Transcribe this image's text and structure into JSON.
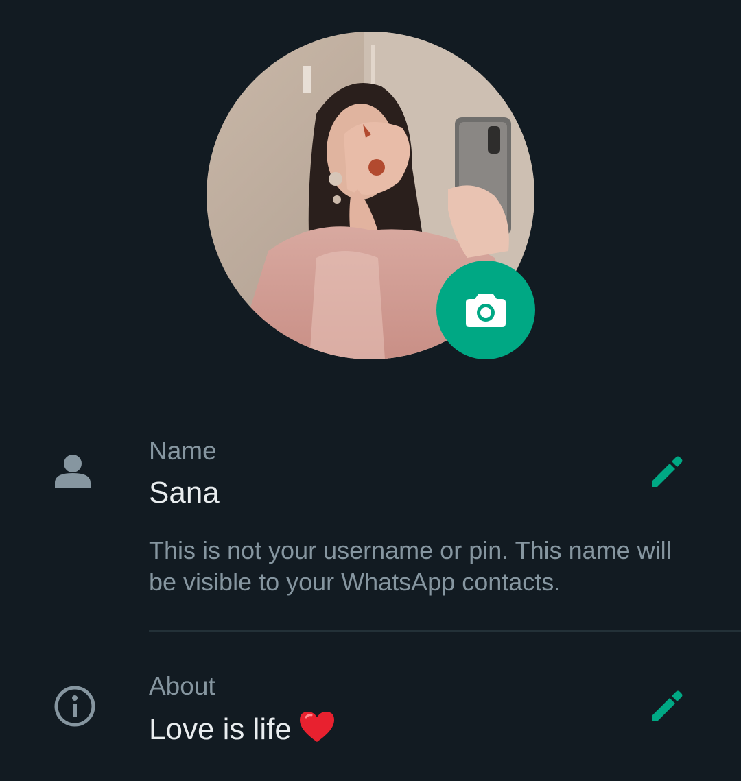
{
  "profile": {
    "photo_alt": "Profile photo",
    "camera_icon": "camera-icon"
  },
  "name_section": {
    "icon": "person-icon",
    "label": "Name",
    "value": "Sana",
    "hint": "This is not your username or pin. This name will be visible to your WhatsApp contacts.",
    "edit_icon": "pencil-icon"
  },
  "about_section": {
    "icon": "info-icon",
    "label": "About",
    "value": "Love is life",
    "emoji_icon": "red-heart-icon",
    "edit_icon": "pencil-icon"
  },
  "colors": {
    "background": "#121b22",
    "accent": "#00a884",
    "primary_text": "#e9edef",
    "secondary_text": "#8696a0"
  }
}
